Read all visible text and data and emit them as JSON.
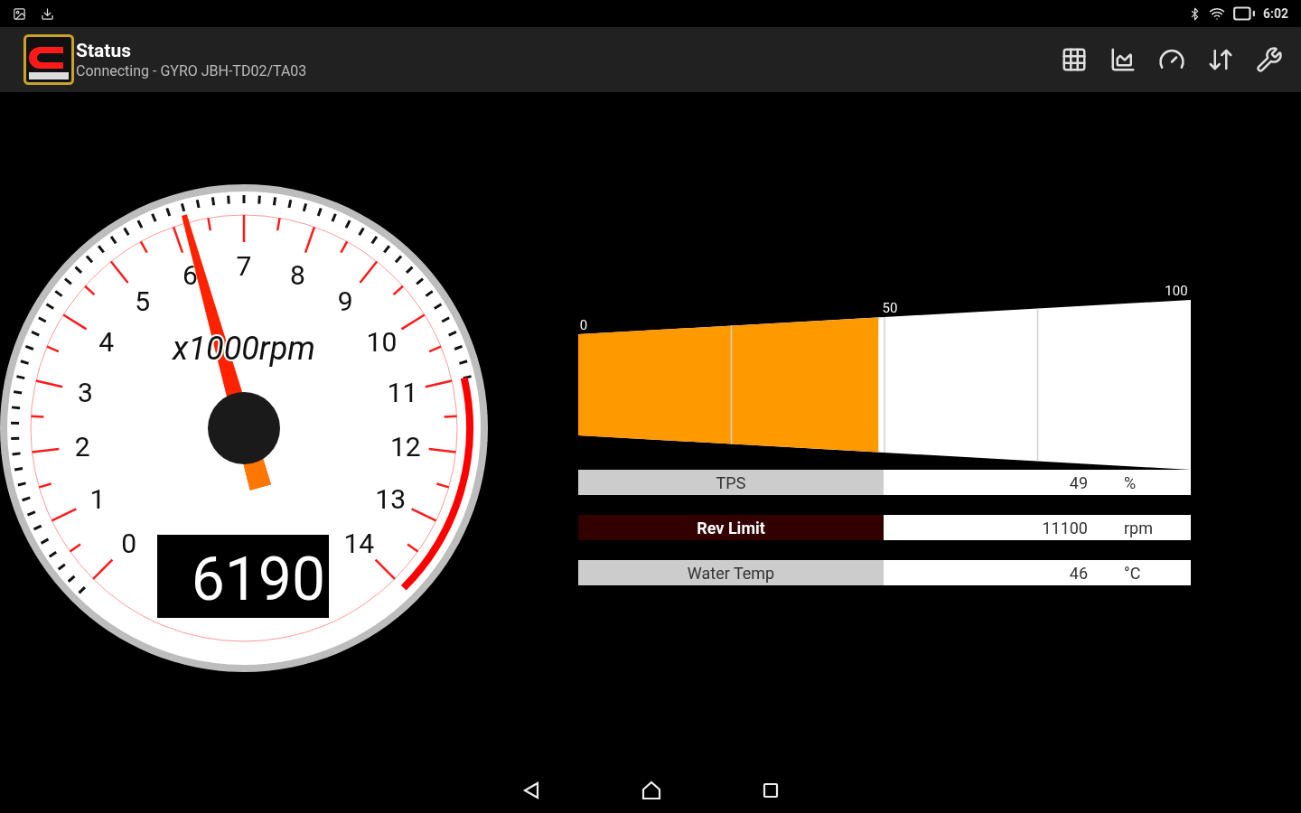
{
  "status_bar": {
    "time": "6:02"
  },
  "app_bar": {
    "title": "Status",
    "subtitle": "Connecting - GYRO JBH-TD02/TA03"
  },
  "tachometer": {
    "unit": "x1000rpm",
    "scale": [
      "7",
      "6",
      "8",
      "5",
      "9",
      "4",
      "10",
      "3",
      "11",
      "2",
      "12",
      "1",
      "13",
      "0",
      "14"
    ],
    "reading": "6190"
  },
  "throttle_bar": {
    "scale": [
      "0",
      "50",
      "100"
    ],
    "level": 0.49
  },
  "readings": [
    {
      "label": "TPS",
      "value": "49",
      "unit": "%",
      "alert": false
    },
    {
      "label": "Rev Limit",
      "value": "11100",
      "unit": "rpm",
      "alert": true
    },
    {
      "label": "Water Temp",
      "value": "46",
      "unit": "°C",
      "alert": false
    }
  ]
}
